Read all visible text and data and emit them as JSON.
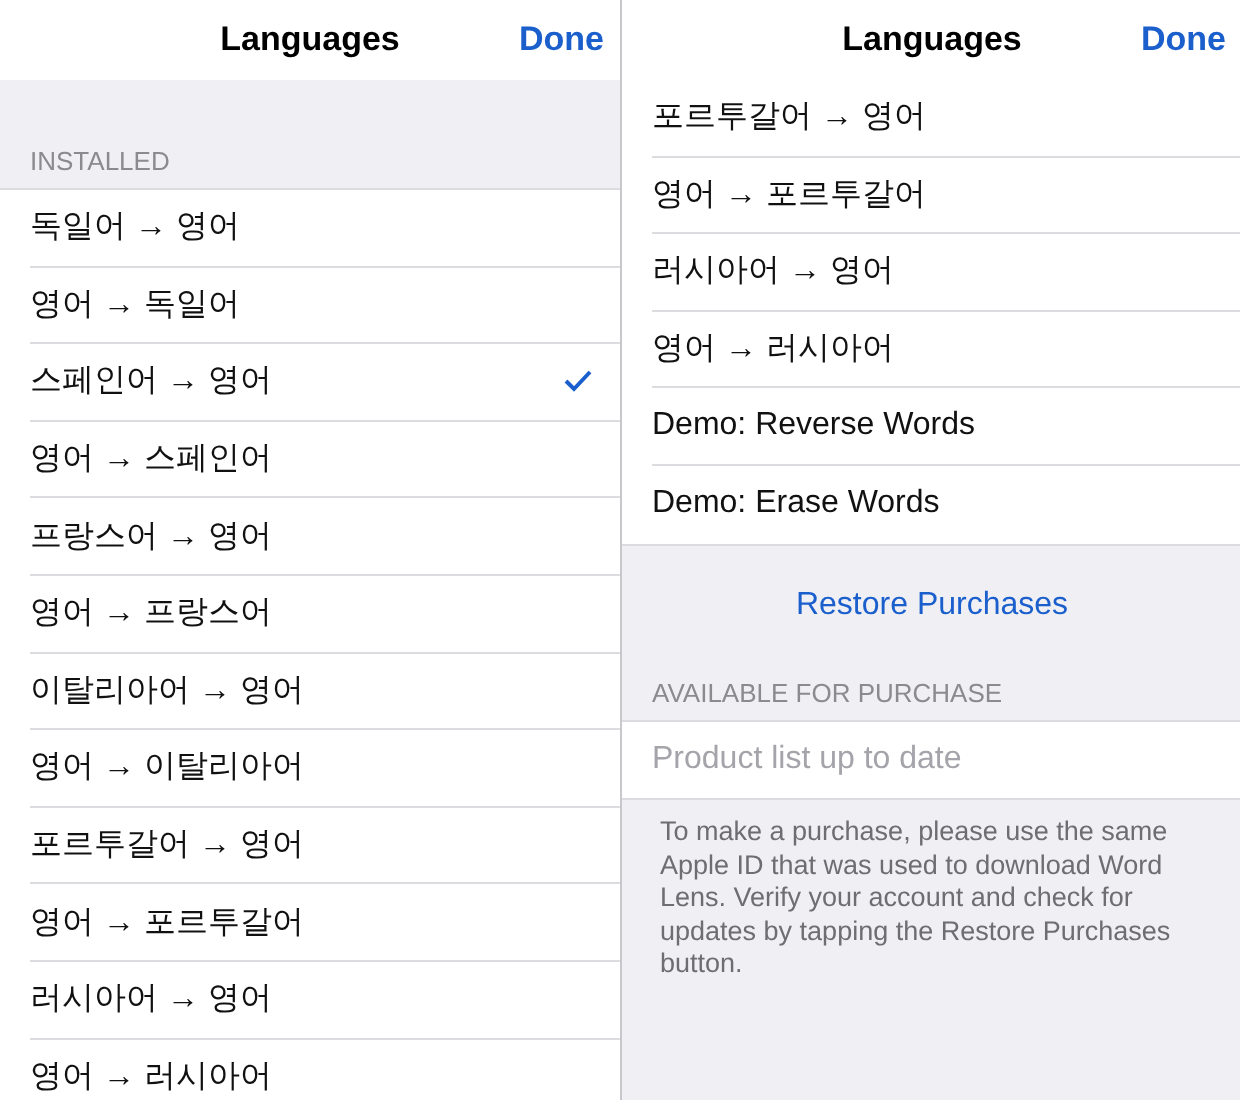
{
  "left_screen": {
    "nav_bar": {
      "title": "Languages",
      "done_button": "Done"
    },
    "section_header": "INSTALLED",
    "items": [
      {
        "label": "독일어 → 영어",
        "selected": false
      },
      {
        "label": "영어 → 독일어",
        "selected": false
      },
      {
        "label": "스페인어 → 영어",
        "selected": true
      },
      {
        "label": "영어 → 스페인어",
        "selected": false
      },
      {
        "label": "프랑스어 → 영어",
        "selected": false
      },
      {
        "label": "영어 → 프랑스어",
        "selected": false
      },
      {
        "label": "이탈리아어 → 영어",
        "selected": false
      },
      {
        "label": "영어 → 이탈리아어",
        "selected": false
      },
      {
        "label": "포르투갈어 → 영어",
        "selected": false
      },
      {
        "label": "영어 → 포르투갈어",
        "selected": false
      },
      {
        "label": "러시아어 → 영어",
        "selected": false
      },
      {
        "label": "영어 → 러시아어",
        "selected": false
      }
    ]
  },
  "right_screen": {
    "nav_bar": {
      "title": "Languages",
      "done_button": "Done"
    },
    "items": [
      {
        "label": "포르투갈어 → 영어",
        "selected": false
      },
      {
        "label": "영어 → 포르투갈어",
        "selected": false
      },
      {
        "label": "러시아어 → 영어",
        "selected": false
      },
      {
        "label": "영어 → 러시아어",
        "selected": false
      },
      {
        "label": "Demo: Reverse Words",
        "selected": false
      },
      {
        "label": "Demo: Erase Words",
        "selected": false
      }
    ],
    "restore_button": "Restore Purchases",
    "section_header": "AVAILABLE FOR PURCHASE",
    "status_row": "Product list up to date",
    "footer": "To make a purchase, please use the same Apple ID that was used to download Word Lens.  Verify your account and check for updates by tapping the Restore Purchases button."
  }
}
